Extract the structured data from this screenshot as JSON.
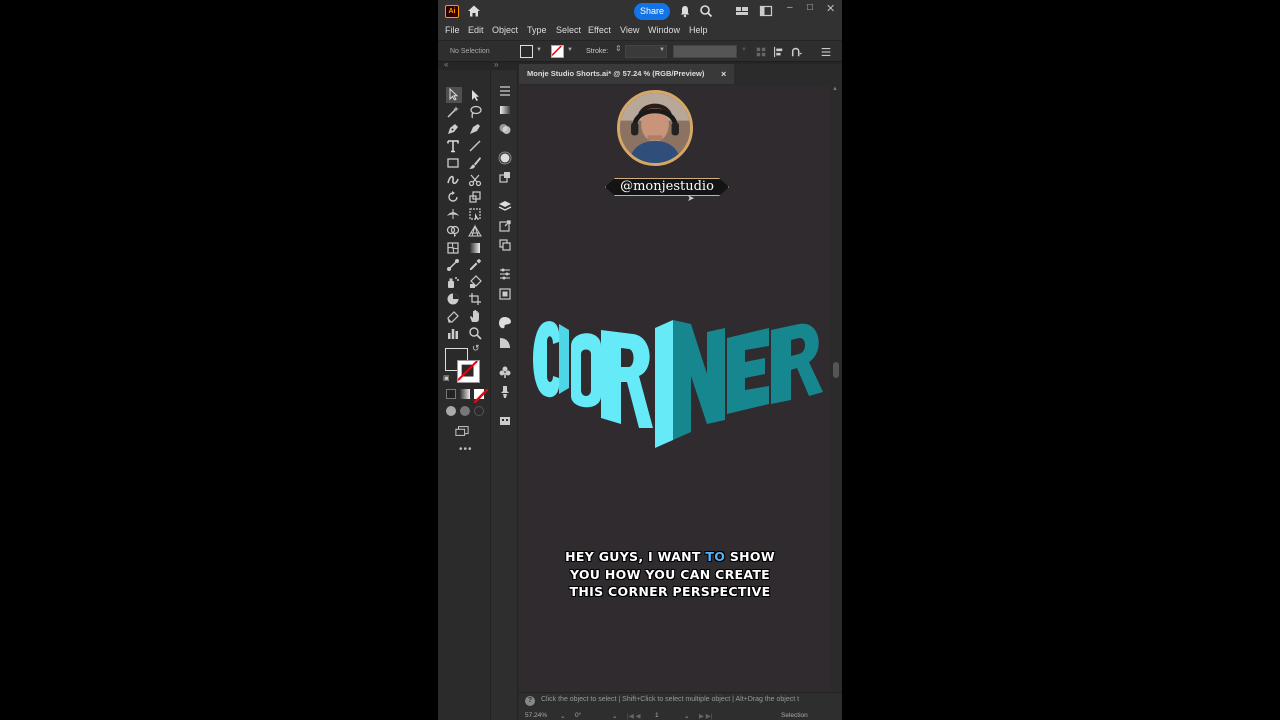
{
  "app": {
    "logo_text": "Ai",
    "share_label": "Share"
  },
  "menu": [
    "File",
    "Edit",
    "Object",
    "Type",
    "Select",
    "Effect",
    "View",
    "Window",
    "Help"
  ],
  "control_bar": {
    "selection_label": "No Selection",
    "stroke_label": "Stroke:"
  },
  "document": {
    "tab_title": "Monje Studio Shorts.ai* @ 57.24 % (RGB/Preview)",
    "close_glyph": "×"
  },
  "canvas": {
    "handle": "@monjestudio",
    "artwork_letters": [
      "C",
      "O",
      "R",
      "N",
      "E",
      "R"
    ],
    "colors": {
      "light": "#66eaf8",
      "light_side": "#4fd6e6",
      "dark": "#17878f",
      "dark_side": "#106d74",
      "background": "#2f2b2e"
    },
    "subtitle": {
      "line1_before": "HEY GUYS, I WANT ",
      "line1_highlight": "TO",
      "line1_after": " SHOW",
      "line2": "YOU HOW YOU CAN CREATE",
      "line3": "THIS CORNER PERSPECTIVE"
    }
  },
  "status": {
    "help_glyph": "?",
    "hint": "Click the object to select  |  Shift+Click to select multiple object  |  Alt+Drag the object t",
    "zoom": "57.24%",
    "rotation": "0°",
    "artboard": "1",
    "mode": "Selection"
  }
}
